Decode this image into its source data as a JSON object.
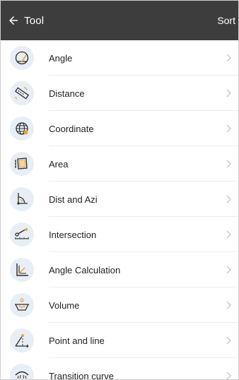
{
  "header": {
    "title": "Tool",
    "sort_label": "Sort"
  },
  "colors": {
    "header_bg": "#3d3d3d",
    "icon_bg": "#e7eef6",
    "icon_stroke": "#2c2c2c",
    "icon_accent": "#e9a63b",
    "chevron": "#bdbdbd"
  },
  "items": [
    {
      "label": "Angle",
      "icon": "protractor-icon"
    },
    {
      "label": "Distance",
      "icon": "ruler-icon"
    },
    {
      "label": "Coordinate",
      "icon": "globe-icon"
    },
    {
      "label": "Area",
      "icon": "area-polygon-icon"
    },
    {
      "label": "Dist and Azi",
      "icon": "distance-azimuth-icon"
    },
    {
      "label": "Intersection",
      "icon": "intersection-icon"
    },
    {
      "label": "Angle Calculation",
      "icon": "angle-calculation-icon"
    },
    {
      "label": "Volume",
      "icon": "volume-icon"
    },
    {
      "label": "Point and line",
      "icon": "point-line-icon"
    },
    {
      "label": "Transition curve",
      "icon": "transition-curve-icon"
    }
  ]
}
